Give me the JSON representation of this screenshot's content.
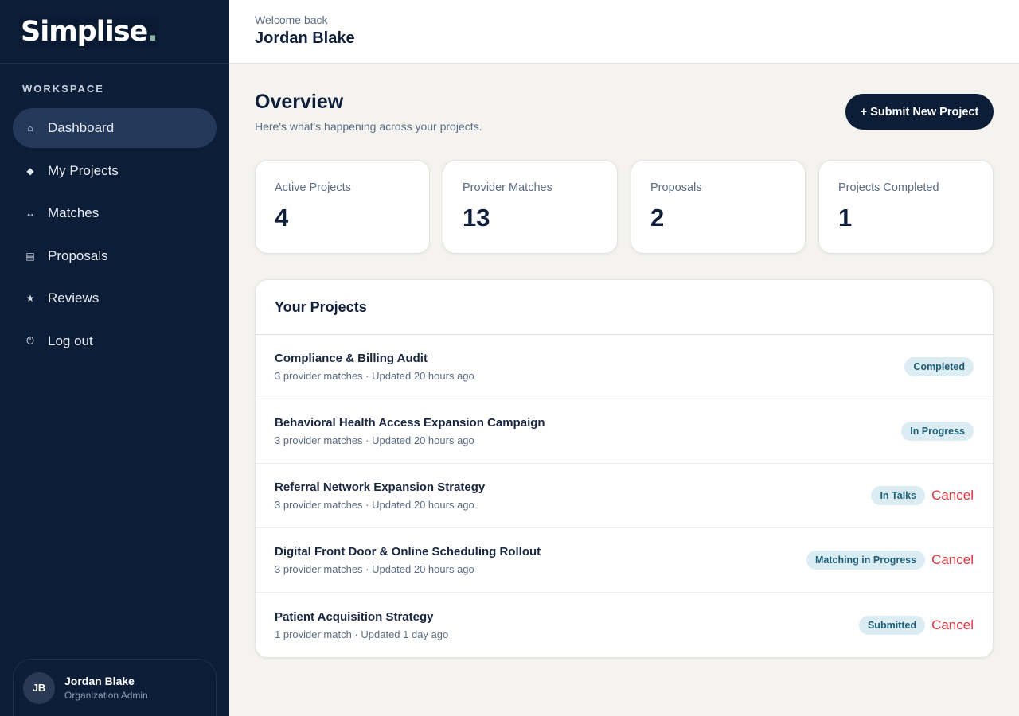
{
  "brand": {
    "name": "Simplise",
    "dot": "."
  },
  "sidebar": {
    "section_label": "WORKSPACE",
    "items": [
      {
        "label": "Dashboard",
        "icon": "⌂",
        "icon_name": "home-icon",
        "active": true
      },
      {
        "label": "My Projects",
        "icon": "◆",
        "icon_name": "diamond-icon",
        "active": false
      },
      {
        "label": "Matches",
        "icon": "↔",
        "icon_name": "arrows-icon",
        "active": false
      },
      {
        "label": "Proposals",
        "icon": "▤",
        "icon_name": "document-icon",
        "active": false
      },
      {
        "label": "Reviews",
        "icon": "★",
        "icon_name": "star-icon",
        "active": false
      },
      {
        "label": "Log out",
        "icon": "⏻",
        "icon_name": "power-icon",
        "active": false
      }
    ],
    "user": {
      "initials": "JB",
      "name": "Jordan Blake",
      "role": "Organization Admin"
    }
  },
  "header": {
    "welcome": "Welcome back",
    "name": "Jordan Blake"
  },
  "overview": {
    "title": "Overview",
    "subtitle": "Here's what's happening across your projects.",
    "submit_label": "+ Submit New Project"
  },
  "stats": [
    {
      "label": "Active Projects",
      "value": "4"
    },
    {
      "label": "Provider Matches",
      "value": "13"
    },
    {
      "label": "Proposals",
      "value": "2"
    },
    {
      "label": "Projects Completed",
      "value": "1"
    }
  ],
  "projects": {
    "title": "Your Projects",
    "cancel_label": "Cancel",
    "rows": [
      {
        "title": "Compliance & Billing Audit",
        "meta": "3 provider matches · Updated 20 hours ago",
        "status": "Completed",
        "cancellable": false
      },
      {
        "title": "Behavioral Health Access Expansion Campaign",
        "meta": "3 provider matches · Updated 20 hours ago",
        "status": "In Progress",
        "cancellable": false
      },
      {
        "title": "Referral Network Expansion Strategy",
        "meta": "3 provider matches · Updated 20 hours ago",
        "status": "In Talks",
        "cancellable": true
      },
      {
        "title": "Digital Front Door & Online Scheduling Rollout",
        "meta": "3 provider matches · Updated 20 hours ago",
        "status": "Matching in Progress",
        "cancellable": true
      },
      {
        "title": "Patient Acquisition Strategy",
        "meta": "1 provider match · Updated 1 day ago",
        "status": "Submitted",
        "cancellable": true
      }
    ]
  },
  "colors": {
    "sidebar_bg": "#0c1d38",
    "accent_cancel": "#e0353c",
    "badge_bg": "#dbecf3",
    "badge_text": "#1f5f78"
  }
}
